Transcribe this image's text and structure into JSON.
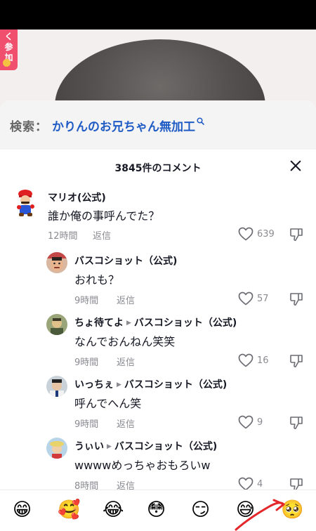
{
  "live_tag": {
    "text": [
      "く",
      "参",
      "加"
    ]
  },
  "search": {
    "prefix": "検索：",
    "term": "かりんのお兄ちゃん無加工"
  },
  "header": {
    "title": "3845件のコメント"
  },
  "comments": [
    {
      "name": "マリオ(公式)",
      "text": "誰か俺の事呼んでた？",
      "time": "12時間",
      "reply": "返信",
      "likes": "639"
    },
    {
      "name": "バスコショット（公式)",
      "text": "おれも？",
      "time": "9時間",
      "reply": "返信",
      "likes": "57"
    },
    {
      "name": "ちょ待てよ",
      "reply_to": "バスコショット（公式)",
      "text": "なんでおんねん笑笑",
      "time": "9時間",
      "reply": "返信",
      "likes": "16"
    },
    {
      "name": "いっちぇ",
      "reply_to": "バスコショット（公式)",
      "text": "呼んでへん笑",
      "time": "9時間",
      "reply": "返信",
      "likes": "9"
    },
    {
      "name": "うぃい",
      "reply_to": "バスコショット（公式)",
      "text": "wwwwめっちゃおもろいw",
      "time": "8時間",
      "reply": "返信",
      "likes": "4"
    }
  ],
  "emojis": [
    "😁",
    "🥰",
    "😂",
    "😳",
    "😏",
    "😅",
    "🥺"
  ],
  "colors": {
    "link": "#1f5bc4",
    "muted": "#8a8b91",
    "text": "#161823",
    "live_tag": "#f0506e"
  }
}
